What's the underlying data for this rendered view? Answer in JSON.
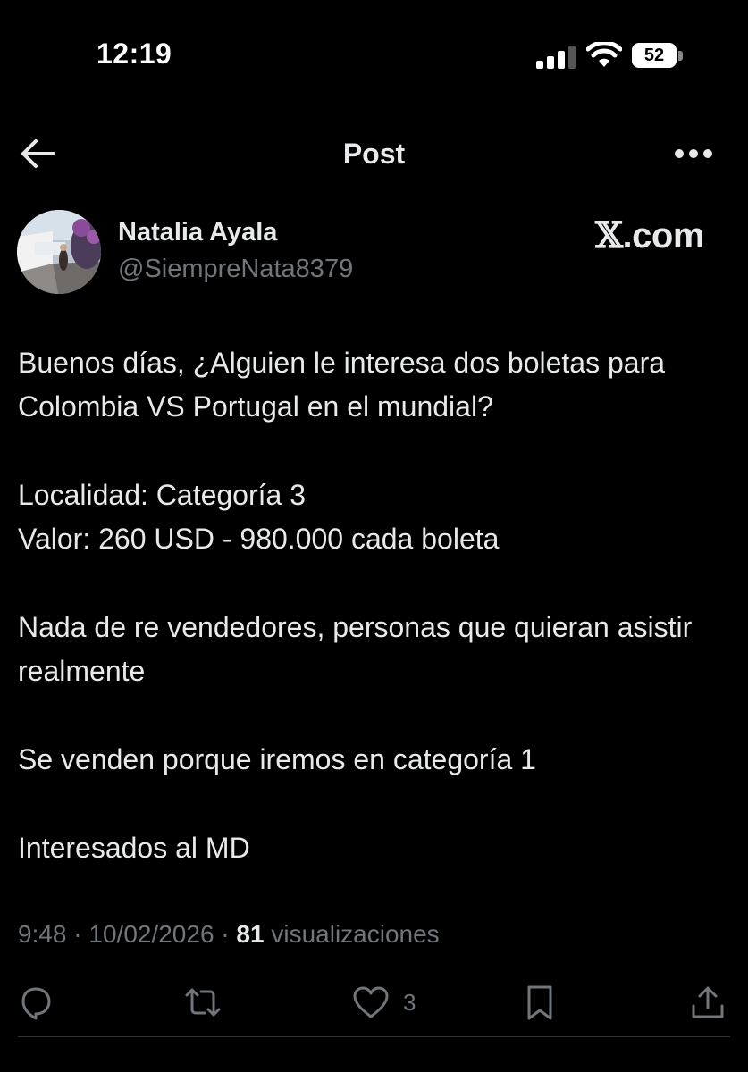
{
  "status_bar": {
    "time": "12:19",
    "battery": "52"
  },
  "header": {
    "title": "Post"
  },
  "author": {
    "name": "Natalia Ayala",
    "handle": "@SiempreNata8379"
  },
  "watermark": {
    "x": "𝕏",
    "suffix": ".com"
  },
  "tweet": {
    "paragraphs": [
      "Buenos días, ¿Alguien le interesa dos boletas para Colombia VS Portugal en el mundial?",
      "Localidad: Categoría 3",
      "Valor: 260 USD - 980.000 cada boleta",
      "Nada de re vendedores, personas que quieran asistir realmente",
      "Se venden porque iremos en categoría 1",
      "Interesados al MD"
    ]
  },
  "meta": {
    "time": "9:48",
    "sep1": " · ",
    "date": "10/02/2026",
    "sep2": " · ",
    "views_count": "81",
    "views_label": " visualizaciones"
  },
  "actions": {
    "like_count": "3"
  },
  "colors": {
    "background": "#000000",
    "text_primary": "#e7e9ea",
    "text_secondary": "#71767b",
    "divider": "#2f3336"
  }
}
